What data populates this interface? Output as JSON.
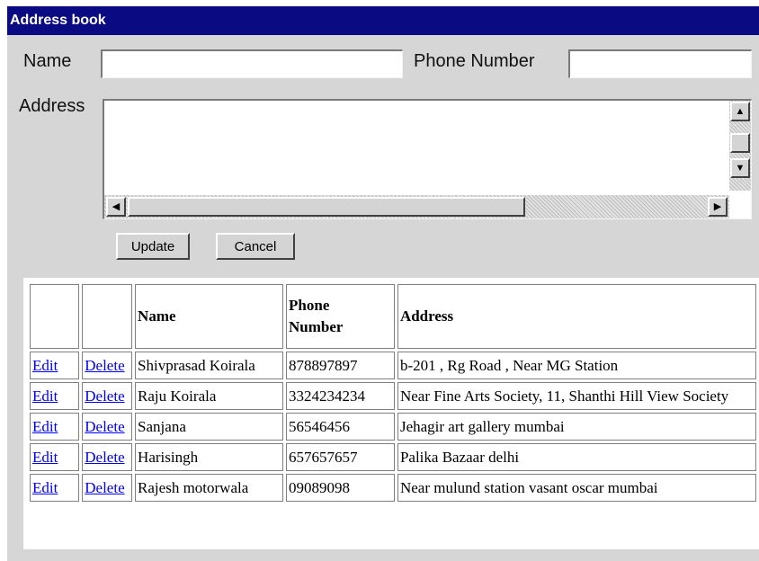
{
  "window": {
    "title": "Address book"
  },
  "form": {
    "name_label": "Name",
    "name_value": "",
    "phone_label": "Phone Number",
    "phone_value": "",
    "address_label": "Address",
    "address_value": "",
    "update_label": "Update",
    "cancel_label": "Cancel"
  },
  "table": {
    "headers": [
      "",
      "",
      "Name",
      "Phone Number",
      "Address"
    ],
    "header_name": "Name",
    "header_phone": "Phone\nNumber",
    "header_address": "Address",
    "rows": [
      {
        "edit": "Edit",
        "delete": "Delete",
        "name": "Shivprasad Koirala",
        "phone": "878897897",
        "address": "b-201 , Rg Road , Near MG Station"
      },
      {
        "edit": "Edit",
        "delete": "Delete",
        "name": "Raju Koirala",
        "phone": "3324234234",
        "address": "Near Fine Arts Society, 11, Shanthi Hill View Society"
      },
      {
        "edit": "Edit",
        "delete": "Delete",
        "name": "Sanjana",
        "phone": "56546456",
        "address": "Jehagir art gallery mumbai"
      },
      {
        "edit": "Edit",
        "delete": "Delete",
        "name": "Harisingh",
        "phone": "657657657",
        "address": "Palika Bazaar delhi"
      },
      {
        "edit": "Edit",
        "delete": "Delete",
        "name": "Rajesh motorwala",
        "phone": "09089098",
        "address": "Near mulund station vasant oscar mumbai"
      }
    ]
  },
  "colors": {
    "titlebar": "#0a0a82",
    "link": "#0000ee",
    "panel": "#d6d6d6"
  }
}
